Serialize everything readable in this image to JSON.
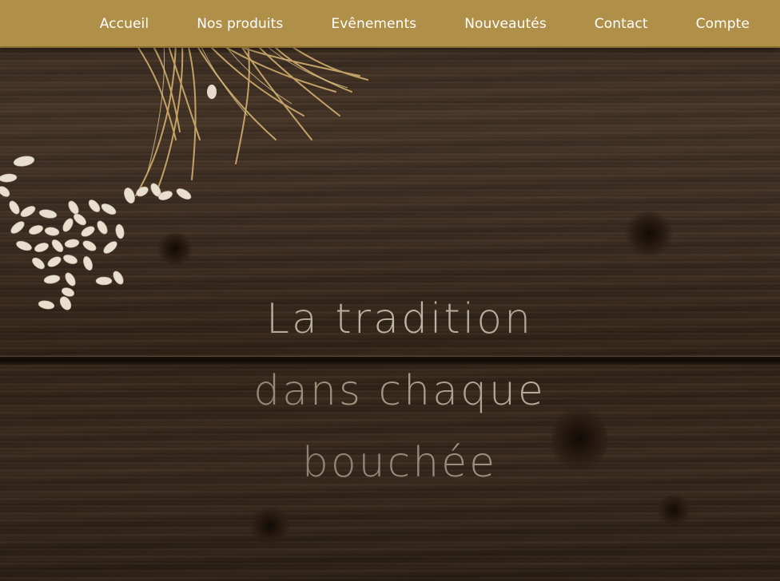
{
  "nav": {
    "items": [
      {
        "label": "Accueil"
      },
      {
        "label": "Nos produits"
      },
      {
        "label": "Evênements"
      },
      {
        "label": "Nouveautés"
      },
      {
        "label": "Contact"
      },
      {
        "label": "Compte"
      }
    ]
  },
  "hero": {
    "tagline": {
      "line1": "La tradition",
      "line2": "dans chaque",
      "line3": "bouchée"
    },
    "background": "wood-planks-with-wheat-and-seeds"
  },
  "colors": {
    "navbar": "#b08f48",
    "nav_text": "#ffffff",
    "tagline": "#b2a792",
    "wood": "#3a2c21"
  }
}
